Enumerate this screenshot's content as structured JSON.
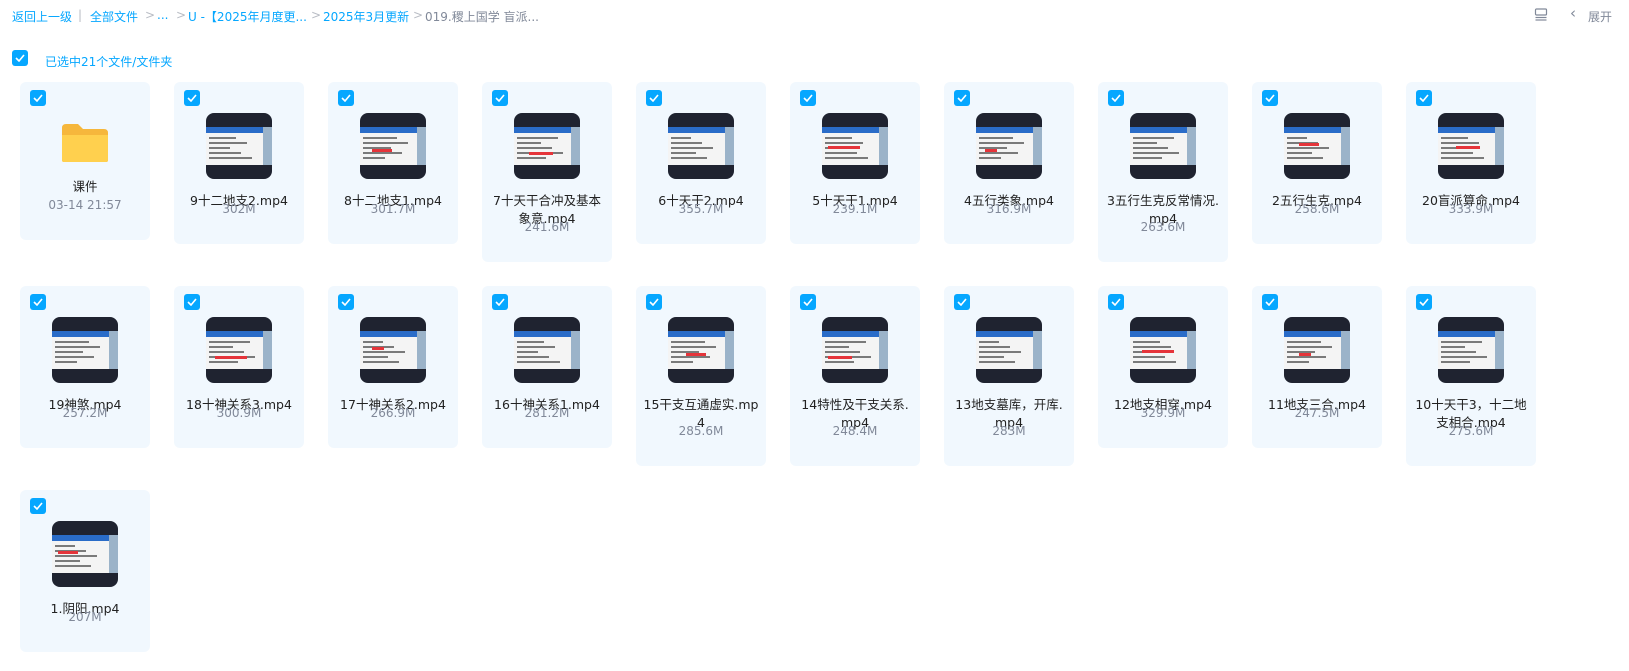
{
  "breadcrumb": {
    "back": "返回上一级",
    "all_files": "全部文件",
    "ellipsis": "...",
    "folder1": "U -【2025年月度更...",
    "folder2": "2025年3月更新",
    "current": "019.稷上国学 盲派..."
  },
  "toolbar": {
    "expand_label": "展开"
  },
  "selection": {
    "text": "已选中21个文件/文件夹"
  },
  "items": [
    {
      "name": "课件",
      "meta": "03-14 21:57"
    },
    {
      "name": "9十二地支2.mp4",
      "meta": "302M"
    },
    {
      "name": "8十二地支1.mp4",
      "meta": "301.7M"
    },
    {
      "name": "7十天干合冲及基本象意.mp4",
      "meta": "241.6M"
    },
    {
      "name": "6十天干2.mp4",
      "meta": "355.7M"
    },
    {
      "name": "5十天干1.mp4",
      "meta": "239.1M"
    },
    {
      "name": "4五行类象.mp4",
      "meta": "316.9M"
    },
    {
      "name": "3五行生克反常情况.mp4",
      "meta": "263.6M"
    },
    {
      "name": "2五行生克.mp4",
      "meta": "258.6M"
    },
    {
      "name": "20盲派算命.mp4",
      "meta": "333.9M"
    },
    {
      "name": "19神煞.mp4",
      "meta": "257.2M"
    },
    {
      "name": "18十神关系3.mp4",
      "meta": "300.9M"
    },
    {
      "name": "17十神关系2.mp4",
      "meta": "266.9M"
    },
    {
      "name": "16十神关系1.mp4",
      "meta": "281.2M"
    },
    {
      "name": "15干支互通虚实.mp4",
      "meta": "285.6M"
    },
    {
      "name": "14特性及干支关系.mp4",
      "meta": "248.4M"
    },
    {
      "name": "13地支墓库，开库.mp4",
      "meta": "283M"
    },
    {
      "name": "12地支相穿.mp4",
      "meta": "329.9M"
    },
    {
      "name": "11地支三合.mp4",
      "meta": "247.5M"
    },
    {
      "name": "10十天干3，十二地支相合.mp4",
      "meta": "275.6M"
    },
    {
      "name": "1.阴阳.mp4",
      "meta": "207M"
    }
  ]
}
